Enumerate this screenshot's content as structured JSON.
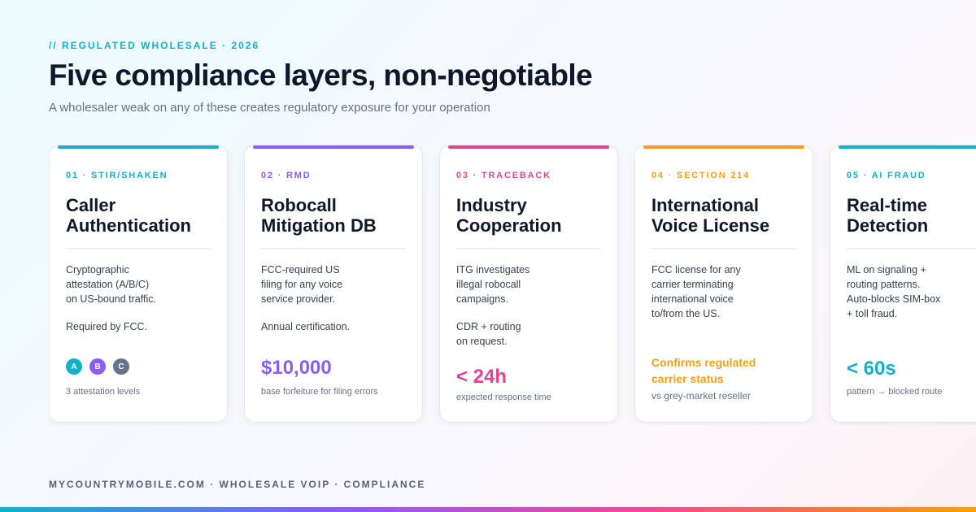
{
  "header": {
    "eyebrow": "// REGULATED WHOLESALE · 2026",
    "title": "Five compliance layers, non-negotiable",
    "subtitle": "A wholesaler weak on any of these creates regulatory exposure for your operation"
  },
  "colors": {
    "cyan": "#14b0c8",
    "purple": "#8b5cf6",
    "pink": "#e04690",
    "amber": "#f2a01a",
    "slate": "#64748b",
    "dark": "#0f172a"
  },
  "cards": [
    {
      "tag": "01 · STIR/SHAKEN",
      "heading": "Caller\nAuthentication",
      "body": "Cryptographic\nattestation (A/B/C)\non US-bound traffic.",
      "body2": "Required by FCC.",
      "badges": [
        "A",
        "B",
        "C"
      ],
      "caption": "3 attestation levels"
    },
    {
      "tag": "02 · RMD",
      "heading": "Robocall\nMitigation DB",
      "body": "FCC-required US\nfiling for any voice\nservice provider.",
      "body2": "Annual certification.",
      "big": "$10,000",
      "caption": "base forfeiture for filing errors"
    },
    {
      "tag": "03 · TRACEBACK",
      "heading": "Industry\nCooperation",
      "body": "ITG investigates\nillegal robocall\ncampaigns.",
      "body2": "CDR + routing\non request.",
      "big": "< 24h",
      "caption": "expected response time"
    },
    {
      "tag": "04 · SECTION 214",
      "heading": "International\nVoice License",
      "body": "FCC license for any\ncarrier terminating\ninternational voice\nto/from the US.",
      "big": "Confirms regulated\ncarrier status",
      "caption": "vs grey-market reseller"
    },
    {
      "tag": "05 · AI FRAUD",
      "heading": "Real-time\nDetection",
      "body": "ML on signaling +\nrouting patterns.\nAuto-blocks SIM-box\n+ toll fraud.",
      "big": "< 60s",
      "caption": "pattern → blocked route"
    }
  ],
  "footer": "MYCOUNTRYMOBILE.COM · WHOLESALE VOIP · COMPLIANCE"
}
